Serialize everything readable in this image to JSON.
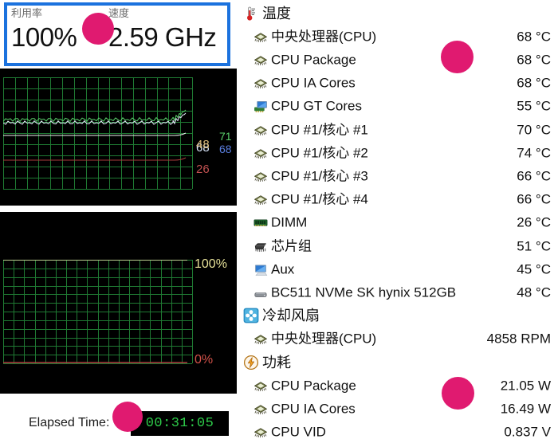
{
  "left": {
    "tiles": [
      {
        "label": "利用率",
        "value": "100%",
        "name": "utilization"
      },
      {
        "label": "速度",
        "value": "2.59 GHz",
        "name": "speed"
      }
    ],
    "elapsed": {
      "label": "Elapsed Time:",
      "value": "00:31:05"
    }
  },
  "chart_data": [
    {
      "type": "line",
      "name": "temperature-graph",
      "title": "",
      "xlabel": "",
      "ylabel": "",
      "ylim": [
        0,
        100
      ],
      "grid": true,
      "legend": "right-inline",
      "annotations": [
        {
          "text": "68",
          "color": "#d7e3f7",
          "value": 68
        },
        {
          "text": "71",
          "color": "#5ad06b",
          "value": 71
        },
        {
          "text": "68",
          "color": "#5a7fe0",
          "value": 68
        },
        {
          "text": "48",
          "color": "#d8b878",
          "value": 48
        },
        {
          "text": "26",
          "color": "#c05050",
          "value": 26
        }
      ],
      "series": [
        {
          "name": "cpu-package-temp",
          "color": "#e8f0ff",
          "value": 68,
          "style": "noisy-flat"
        },
        {
          "name": "cpu-core-temp",
          "color": "#5ad06b",
          "value": 71,
          "style": "noisy-flat"
        },
        {
          "name": "aux-temp",
          "color": "#f2f2f2",
          "value": 48,
          "style": "flat"
        },
        {
          "name": "dimm-temp",
          "color": "#a83c3c",
          "value": 26,
          "style": "flat"
        }
      ]
    },
    {
      "type": "line",
      "name": "usage-graph",
      "title": "",
      "xlabel": "",
      "ylabel": "",
      "ylim": [
        0,
        100
      ],
      "grid": true,
      "annotations": [
        {
          "text": "100%",
          "color": "#e8e39a",
          "value": 100
        },
        {
          "text": "0%",
          "color": "#d4524a",
          "value": 0
        }
      ],
      "series": [
        {
          "name": "usage-top-rail",
          "color": "#ede9b0",
          "value": 100,
          "style": "flat"
        },
        {
          "name": "usage-bottom-rail",
          "color": "#b04040",
          "value": 0,
          "style": "flat"
        }
      ]
    }
  ],
  "right": {
    "groups": [
      {
        "name": "temperature",
        "icon": "thermometer-icon",
        "label": "温度",
        "items": [
          {
            "icon": "cpu-chip-icon",
            "label": "中央处理器(CPU)",
            "value": "68 °C"
          },
          {
            "icon": "cpu-chip-icon",
            "label": "CPU Package",
            "value": "68 °C"
          },
          {
            "icon": "cpu-chip-icon",
            "label": "CPU IA Cores",
            "value": "68 °C"
          },
          {
            "icon": "gpu-monitor-icon",
            "label": "CPU GT Cores",
            "value": "55 °C"
          },
          {
            "icon": "cpu-chip-icon",
            "label": "CPU #1/核心 #1",
            "value": "70 °C"
          },
          {
            "icon": "cpu-chip-icon",
            "label": "CPU #1/核心 #2",
            "value": "74 °C"
          },
          {
            "icon": "cpu-chip-icon",
            "label": "CPU #1/核心 #3",
            "value": "66 °C"
          },
          {
            "icon": "cpu-chip-icon",
            "label": "CPU #1/核心 #4",
            "value": "66 °C"
          },
          {
            "icon": "dimm-ram-icon",
            "label": "DIMM",
            "value": "26 °C"
          },
          {
            "icon": "chipset-icon",
            "label": "芯片组",
            "value": "51 °C"
          },
          {
            "icon": "monitor-icon",
            "label": "Aux",
            "value": "45 °C"
          },
          {
            "icon": "disk-drive-icon",
            "label": "BC511 NVMe SK hynix 512GB",
            "value": "48 °C"
          }
        ]
      },
      {
        "name": "cooling-fans",
        "icon": "fan-icon",
        "label": "冷却风扇",
        "items": [
          {
            "icon": "cpu-chip-icon",
            "label": "中央处理器(CPU)",
            "value": "4858 RPM"
          }
        ]
      },
      {
        "name": "power",
        "icon": "lightning-bolt-icon",
        "label": "功耗",
        "items": [
          {
            "icon": "cpu-chip-icon",
            "label": "CPU Package",
            "value": "21.05 W"
          },
          {
            "icon": "cpu-chip-icon",
            "label": "CPU IA Cores",
            "value": "16.49 W"
          },
          {
            "icon": "cpu-chip-icon",
            "label": "CPU VID",
            "value": "0.837 V"
          }
        ]
      }
    ]
  },
  "annotations": {
    "highlight_color": "#1b72de",
    "dot_color": "#e01a70"
  }
}
